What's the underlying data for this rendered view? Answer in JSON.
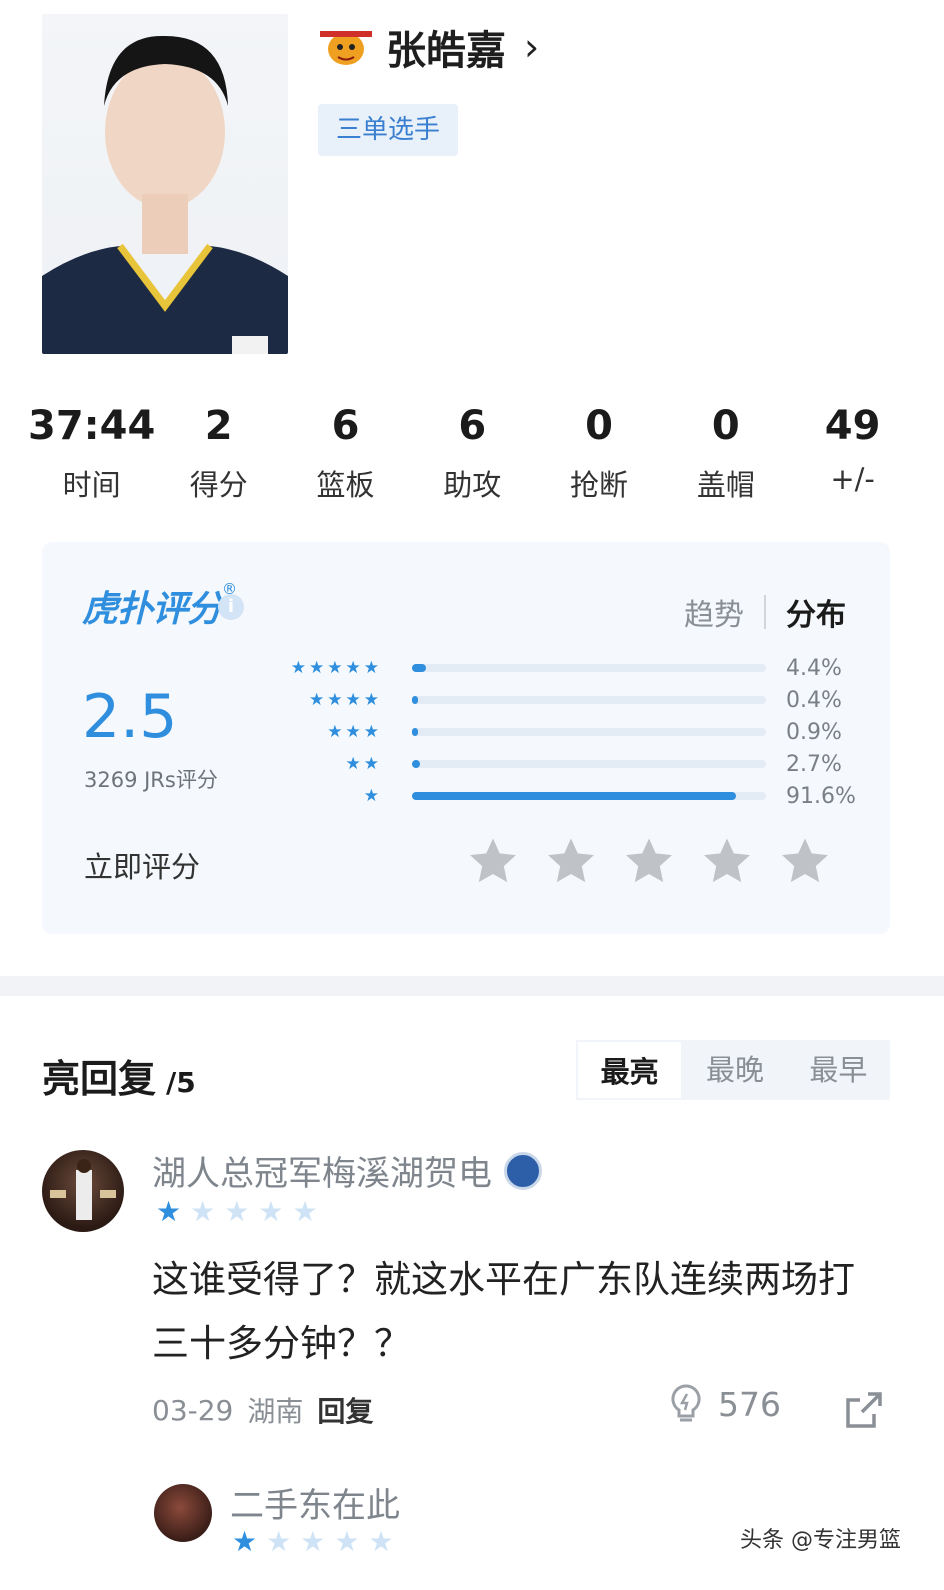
{
  "player": {
    "name": "张皓嘉",
    "chevron": "›",
    "badge": "三单选手"
  },
  "stats": [
    {
      "value": "37:44",
      "label": "时间"
    },
    {
      "value": "2",
      "label": "得分"
    },
    {
      "value": "6",
      "label": "篮板"
    },
    {
      "value": "6",
      "label": "助攻"
    },
    {
      "value": "0",
      "label": "抢断"
    },
    {
      "value": "0",
      "label": "盖帽"
    },
    {
      "value": "49",
      "label": "+/-"
    }
  ],
  "rating": {
    "logo_text": "虎扑评分",
    "logo_mark": "®",
    "info_icon": "i",
    "tab_trend": "趋势",
    "tab_distribution": "分布",
    "score": "2.5",
    "count": "3269 JRs评分",
    "rate_now": "立即评分",
    "distribution": [
      {
        "stars": 5,
        "stars_text": "★★★★★",
        "pct_label": "4.4%",
        "pct": 4.4
      },
      {
        "stars": 4,
        "stars_text": "★★★★",
        "pct_label": "0.4%",
        "pct": 0.4
      },
      {
        "stars": 3,
        "stars_text": "★★★",
        "pct_label": "0.9%",
        "pct": 0.9
      },
      {
        "stars": 2,
        "stars_text": "★★",
        "pct_label": "2.7%",
        "pct": 2.7
      },
      {
        "stars": 1,
        "stars_text": "★",
        "pct_label": "91.6%",
        "pct": 91.6
      }
    ],
    "accent_color": "#2f8fde"
  },
  "replies": {
    "title": "亮回复",
    "count": "/5",
    "sort_tabs": [
      "最亮",
      "最晚",
      "最早"
    ],
    "active_sort": "最亮",
    "items": [
      {
        "username": "湖人总冠军梅溪湖贺电",
        "rating": 1,
        "text": "这谁受得了？就这水平在广东队连续两场打三十多分钟？？",
        "date": "03-29",
        "location": "湖南",
        "reply_label": "回复",
        "likes": "576"
      },
      {
        "username": "二手东在此",
        "rating": 1
      }
    ]
  },
  "watermark": "头条 @专注男篮"
}
